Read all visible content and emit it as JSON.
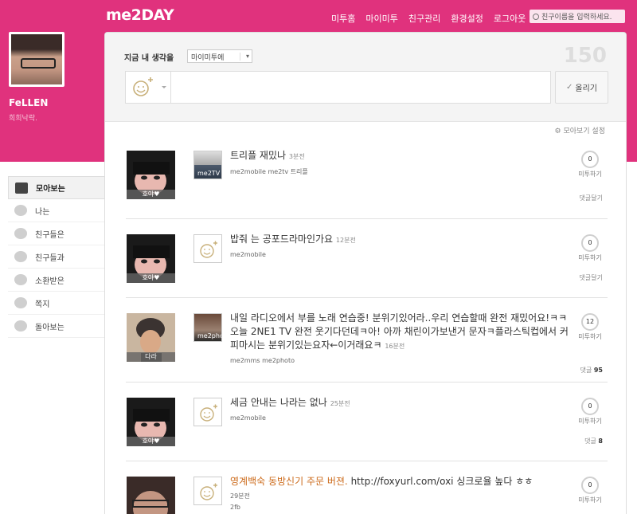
{
  "header": {
    "logo": "me2DAY",
    "nav": [
      "미투홈",
      "마이미투",
      "친구관리",
      "환경설정",
      "로그아웃"
    ],
    "search_placeholder": "친구이름을 입력하세요."
  },
  "profile": {
    "name": "FeLLEN",
    "subtitle": "희희낙락."
  },
  "sidebar": {
    "items": [
      {
        "label": "모아보는",
        "icon": "collect-icon",
        "active": true
      },
      {
        "label": "나는",
        "icon": "me-icon"
      },
      {
        "label": "친구들은",
        "icon": "friends-icon"
      },
      {
        "label": "친구들과",
        "icon": "chat-icon"
      },
      {
        "label": "소환받은",
        "icon": "summon-icon"
      },
      {
        "label": "쪽지",
        "icon": "note-icon"
      },
      {
        "label": "돌아보는",
        "icon": "footprint-icon"
      }
    ]
  },
  "composer": {
    "label": "지금 내 생각을",
    "scope": "마이미투에",
    "char_count": "150",
    "post_label": "올리기"
  },
  "feed_settings": "모아보기 설정",
  "posts": [
    {
      "avatar_label": "호야♥",
      "message": "트리플 재밌나",
      "time": "3분전",
      "meta": "me2mobile    me2tv 트리플",
      "me2_count": "0",
      "me2_label": "미투하기",
      "reply": "댓글달기",
      "reply_count": ""
    },
    {
      "avatar_label": "호야♥",
      "message": "밥줘 는 공포드라마인가요",
      "time": "12분전",
      "meta": "me2mobile",
      "me2_count": "0",
      "me2_label": "미투하기",
      "reply": "댓글달기",
      "reply_count": ""
    },
    {
      "avatar_label": "다라",
      "message": "내일 라디오에서 부를 노래 연습중! 분위기있어라..우리 연습할때 완전 재밌어요!ㅋㅋ오늘 2NE1 TV 완전 웃기다던데ㅋ아! 아까 채린이가보낸거 문자ㅋ플라스틱컵에서 커피마시는 분위기있는요자←이거래요ㅋ",
      "time": "16분전",
      "meta": "me2mms me2photo",
      "me2_count": "12",
      "me2_label": "미투하기",
      "reply": "댓글",
      "reply_count": "95"
    },
    {
      "avatar_label": "호야♥",
      "message": "세금 안내는 나라는 없나",
      "time": "25분전",
      "meta": "me2mobile",
      "me2_count": "0",
      "me2_label": "미투하기",
      "reply": "댓글",
      "reply_count": "8"
    },
    {
      "avatar_label": "",
      "message_highlight": "영계백숙 동방신기 주문 버젼.",
      "message": "http://foxyurl.com/oxi 싱크로율 높다 ㅎㅎ",
      "time": "29분전",
      "meta": "2fb",
      "me2_count": "0",
      "me2_label": "미투하기",
      "reply": "",
      "reply_count": ""
    }
  ],
  "colors": {
    "brand": "#e0327d",
    "highlight": "#cc6a1a"
  }
}
